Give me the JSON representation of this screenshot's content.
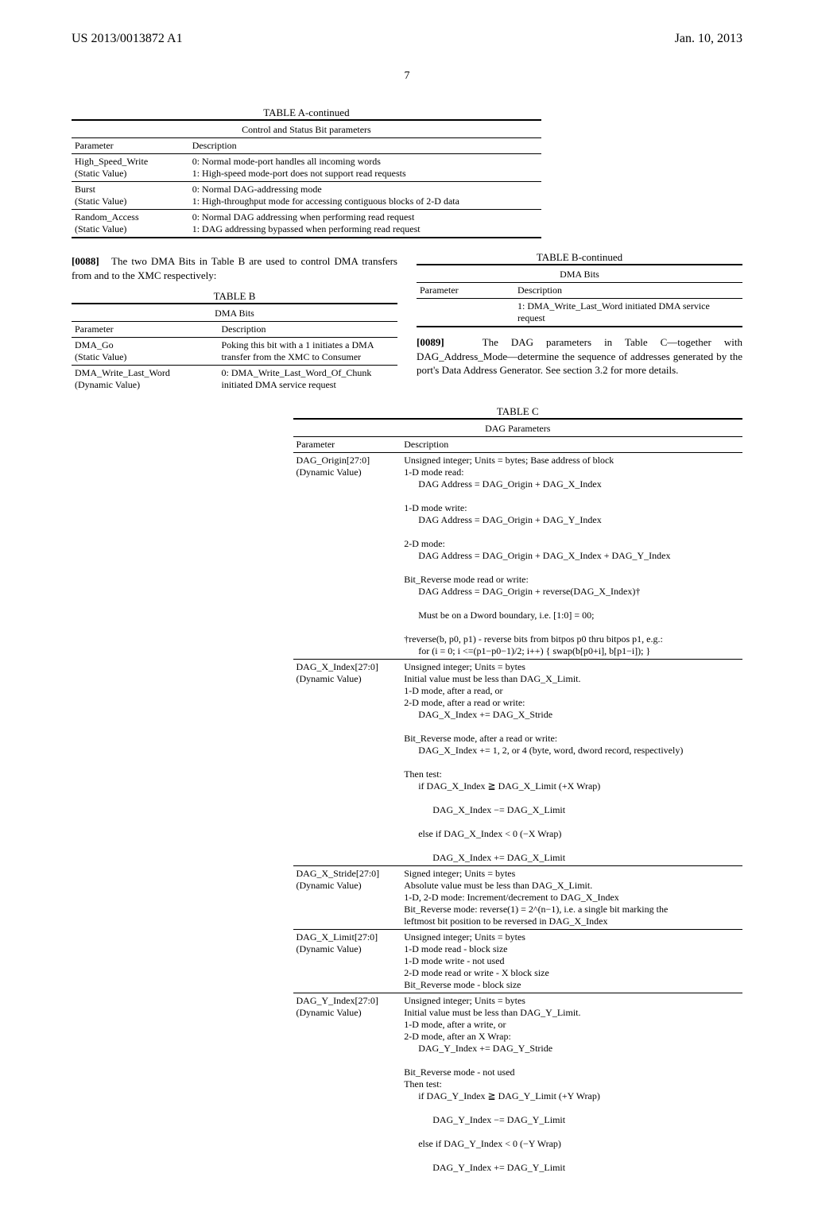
{
  "header": {
    "left": "US 2013/0013872 A1",
    "right": "Jan. 10, 2013"
  },
  "page_number": "7",
  "tableA": {
    "title": "TABLE A-continued",
    "subtitle": "Control and Status Bit parameters",
    "col1": "Parameter",
    "col2": "Description",
    "rows": [
      {
        "param": "High_Speed_Write\n(Static Value)",
        "desc": "0: Normal mode-port handles all incoming words\n1: High-speed mode-port does not support read requests"
      },
      {
        "param": "Burst\n(Static Value)",
        "desc": "0: Normal DAG-addressing mode\n1: High-throughput mode for accessing contiguous blocks of 2-D data"
      },
      {
        "param": "Random_Access\n(Static Value)",
        "desc": "0: Normal DAG addressing when performing read request\n1: DAG addressing bypassed when performing read request"
      }
    ]
  },
  "para88": {
    "num": "[0088]",
    "text": "The two DMA Bits in Table B are used to control DMA transfers from and to the XMC respectively:"
  },
  "tableB_left": {
    "title": "TABLE B",
    "subtitle": "DMA Bits",
    "col1": "Parameter",
    "col2": "Description",
    "rows": [
      {
        "param": "DMA_Go\n(Static Value)",
        "desc": "Poking this bit with a 1 initiates a DMA transfer from the XMC to Consumer"
      },
      {
        "param": "DMA_Write_Last_Word\n(Dynamic Value)",
        "desc": "0: DMA_Write_Last_Word_Of_Chunk initiated DMA service request"
      }
    ]
  },
  "tableB_right": {
    "title": "TABLE B-continued",
    "subtitle": "DMA Bits",
    "col1": "Parameter",
    "col2": "Description",
    "rows": [
      {
        "param": "",
        "desc": "1: DMA_Write_Last_Word initiated DMA service request"
      }
    ]
  },
  "para89": {
    "num": "[0089]",
    "text": "The DAG parameters in Table C—together with DAG_Address_Mode—determine the sequence of addresses generated by the port's Data Address Generator. See section 3.2 for more details."
  },
  "tableC": {
    "title": "TABLE C",
    "subtitle": "DAG Parameters",
    "col1": "Parameter",
    "col2": "Description",
    "rows": [
      {
        "param": "DAG_Origin[27:0]\n(Dynamic Value)",
        "desc_lines": [
          "Unsigned integer; Units = bytes; Base address of block",
          "1-D mode read:",
          "    DAG Address = DAG_Origin + DAG_X_Index",
          "1-D mode write:",
          "    DAG Address = DAG_Origin + DAG_Y_Index",
          "2-D mode:",
          "    DAG Address = DAG_Origin + DAG_X_Index + DAG_Y_Index",
          "Bit_Reverse mode read or write:",
          "    DAG Address = DAG_Origin + reverse(DAG_X_Index)†",
          "    Must be on a Dword boundary, i.e. [1:0] = 00;",
          "†reverse(b, p0, p1) - reverse bits from bitpos p0 thru bitpos p1, e.g.:",
          "    for (i = 0; i <=(p1−p0−1)/2; i++) { swap(b[p0+i], b[p1−i]); }"
        ]
      },
      {
        "param": "DAG_X_Index[27:0]\n(Dynamic Value)",
        "desc_lines": [
          "Unsigned integer; Units = bytes",
          "Initial value must be less than DAG_X_Limit.",
          "1-D mode, after a read, or",
          "2-D mode, after a read or write:",
          "    DAG_X_Index += DAG_X_Stride",
          "Bit_Reverse mode, after a read or write:",
          "    DAG_X_Index += 1, 2, or 4 (byte, word, dword record, respectively)",
          "Then test:",
          "    if DAG_X_Index ≧ DAG_X_Limit (+X Wrap)",
          "        DAG_X_Index −= DAG_X_Limit",
          "    else if DAG_X_Index < 0 (−X Wrap)",
          "        DAG_X_Index += DAG_X_Limit"
        ]
      },
      {
        "param": "DAG_X_Stride[27:0]\n(Dynamic Value)",
        "desc_lines": [
          "Signed integer; Units = bytes",
          "Absolute value must be less than DAG_X_Limit.",
          "1-D, 2-D mode: Increment/decrement to DAG_X_Index",
          "Bit_Reverse mode: reverse(1) = 2^(n−1), i.e. a single bit marking the",
          "leftmost bit position to be reversed in DAG_X_Index"
        ]
      },
      {
        "param": "DAG_X_Limit[27:0]\n(Dynamic Value)",
        "desc_lines": [
          "Unsigned integer; Units = bytes",
          "1-D mode read - block size",
          "1-D mode write - not used",
          "2-D mode read or write - X block size",
          "Bit_Reverse mode - block size"
        ]
      },
      {
        "param": "DAG_Y_Index[27:0]\n(Dynamic Value)",
        "desc_lines": [
          "Unsigned integer; Units = bytes",
          "Initial value must be less than DAG_Y_Limit.",
          "1-D mode, after a write, or",
          "2-D mode, after an X Wrap:",
          "    DAG_Y_Index += DAG_Y_Stride",
          "Bit_Reverse mode - not used",
          "Then test:",
          "    if DAG_Y_Index ≧ DAG_Y_Limit (+Y Wrap)",
          "        DAG_Y_Index −= DAG_Y_Limit",
          "    else if DAG_Y_Index < 0 (−Y Wrap)",
          "        DAG_Y_Index += DAG_Y_Limit"
        ]
      }
    ]
  }
}
